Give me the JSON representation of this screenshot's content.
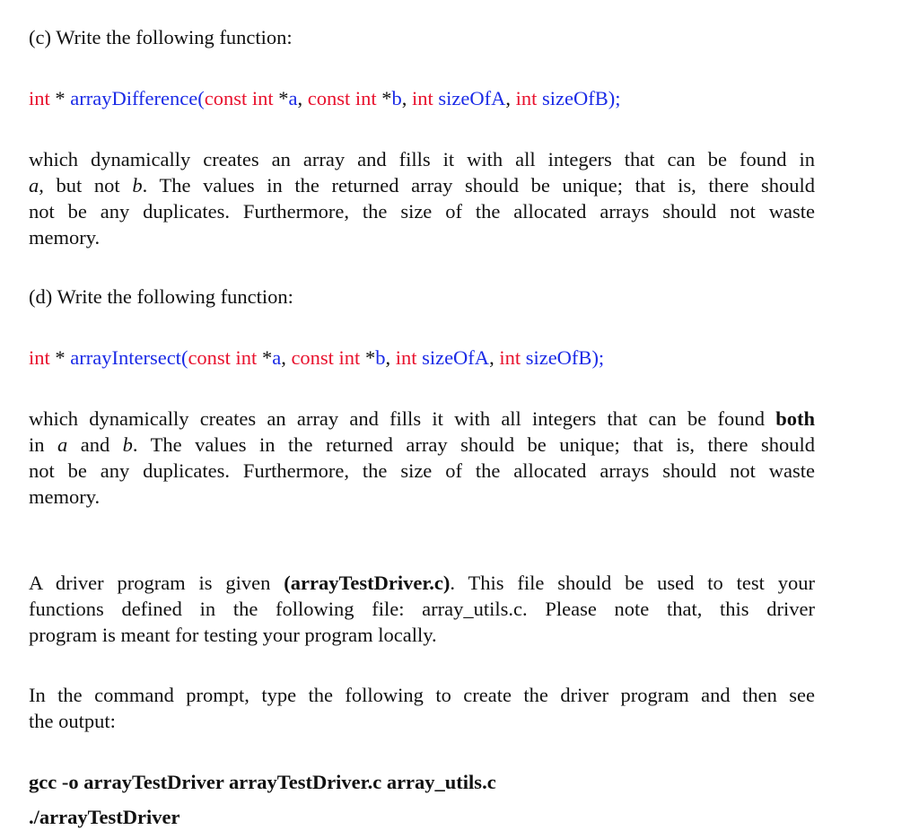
{
  "part_c": {
    "heading": "(c) Write the following function:",
    "signature": {
      "ret_type": "int",
      "star": " * ",
      "name": "arrayDifference",
      "open_paren": "(",
      "p1_type": "const int",
      "p1_star": " *",
      "p1_name": "a",
      "sep1": ", ",
      "p2_type": "const int",
      "p2_star": " *",
      "p2_name": "b",
      "sep2": ", ",
      "p3_type": "int",
      "p3_name": " sizeOfA",
      "sep3": ", ",
      "p4_type": "int",
      "p4_name": " sizeOfB",
      "close": ");"
    },
    "desc_lines": [
      "which dynamically creates an array and fills it with all integers that can be found in",
      ", but not ",
      ". The values in the returned array should be unique; that is, there should",
      "not be any duplicates. Furthermore, the size of the allocated arrays should not waste",
      "memory."
    ],
    "var_a": "a",
    "var_b": "b"
  },
  "part_d": {
    "heading": "(d) Write the following function:",
    "signature": {
      "ret_type": "int",
      "star": " * ",
      "name": "arrayIntersect",
      "open_paren": "(",
      "p1_type": "const int",
      "p1_star": " *",
      "p1_name": "a",
      "sep1": ", ",
      "p2_type": "const int",
      "p2_star": " *",
      "p2_name": "b",
      "sep2": ", ",
      "p3_type": "int",
      "p3_name": " sizeOfA",
      "sep3": ", ",
      "p4_type": "int",
      "p4_name": " sizeOfB",
      "close": ");"
    },
    "desc_line1_pre": "which dynamically creates an array and fills it with all integers that can be found ",
    "desc_line1_bold": "both",
    "desc_line2_pre": "in ",
    "desc_line2_mid": " and ",
    "desc_line2_post": ". The values in the returned array should be unique; that is, there should",
    "desc_line3": "not be any duplicates. Furthermore, the size of the allocated arrays should not waste",
    "desc_line4": "memory.",
    "var_a": "a",
    "var_b": "b"
  },
  "driver": {
    "line1_pre": "A driver program is given ",
    "line1_bold": "(arrayTestDriver.c)",
    "line1_post": ". This file should be used to test your",
    "line2": "functions defined in the following file: array_utils.c. Please note that, this driver",
    "line3": "program is meant for testing your program locally."
  },
  "instructions": {
    "line1": "In the command prompt, type the following to create the driver program and then see",
    "line2": "the output:"
  },
  "commands": {
    "compile": "gcc -o arrayTestDriver arrayTestDriver.c array_utils.c",
    "run": "./arrayTestDriver"
  }
}
